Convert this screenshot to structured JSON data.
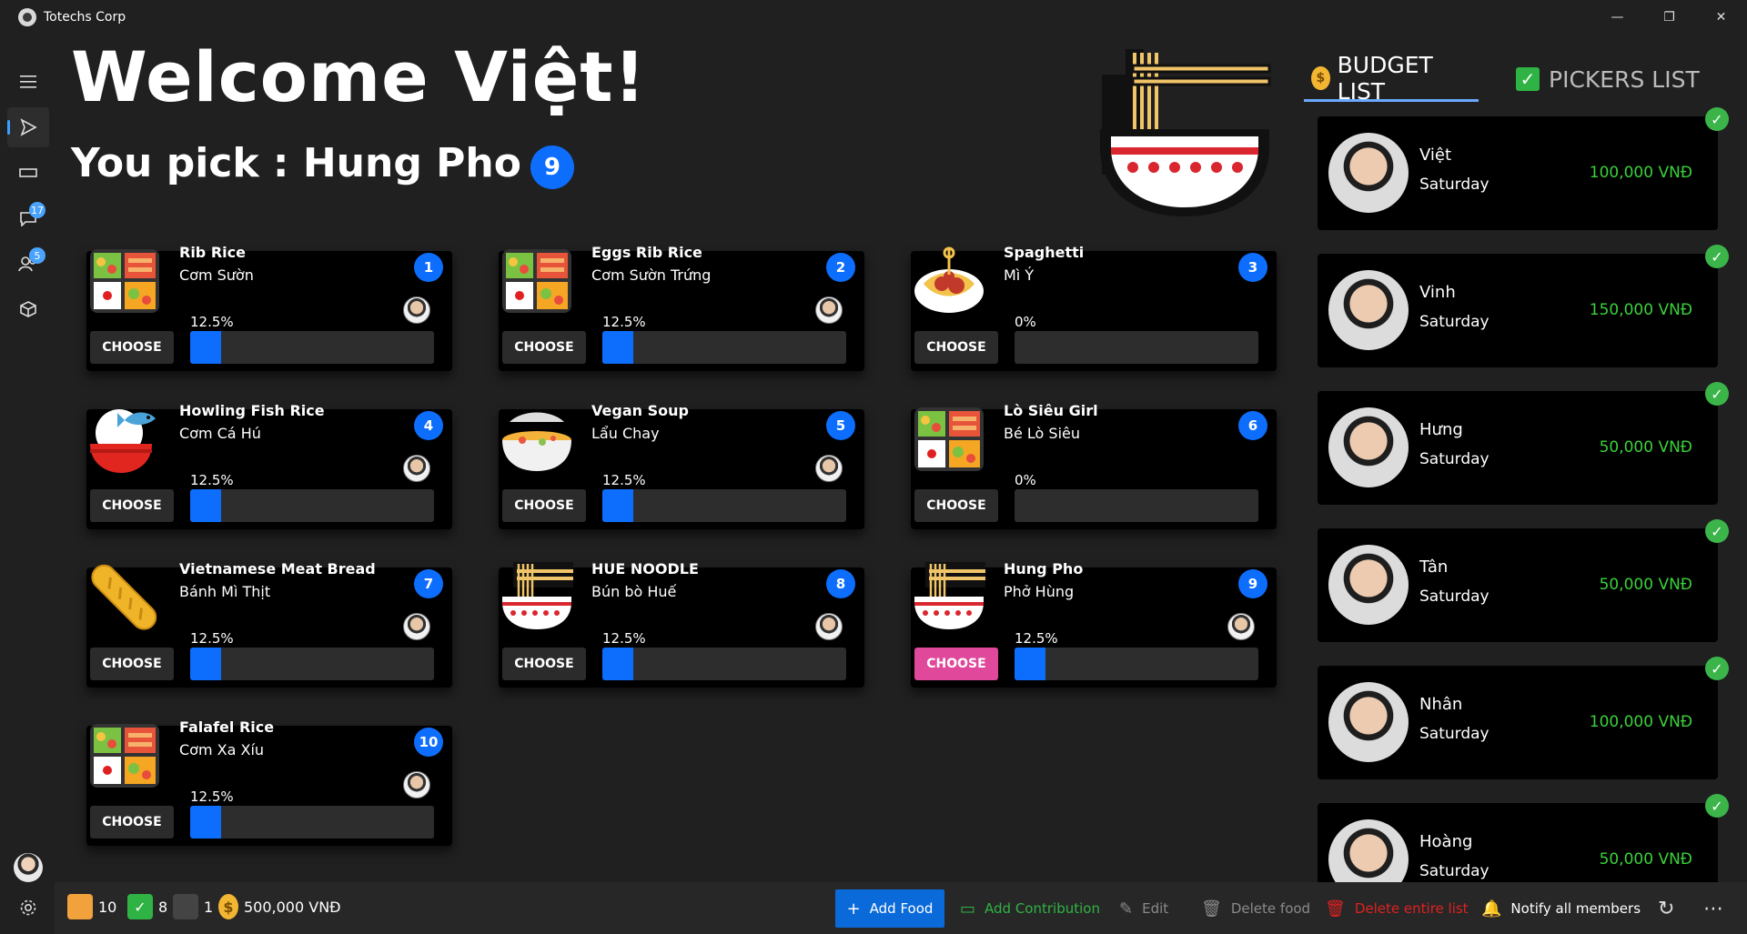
{
  "window": {
    "title": "Totechs Corp",
    "controls": [
      "—",
      "❐",
      "✕"
    ]
  },
  "rail": {
    "items": [
      {
        "name": "menu",
        "icon": "hamburger-icon"
      },
      {
        "name": "food",
        "icon": "send-icon"
      },
      {
        "name": "tray",
        "icon": "tray-icon"
      },
      {
        "name": "chat",
        "icon": "chat-icon",
        "badge": "17"
      },
      {
        "name": "people",
        "icon": "people-icon",
        "badge": "5"
      },
      {
        "name": "box",
        "icon": "package-icon"
      }
    ]
  },
  "header": {
    "welcome": "Welcome Việt!",
    "pick_prefix": "You pick : Hung Pho",
    "pick_number": "9"
  },
  "foods": [
    {
      "name": "Rib Rice",
      "sub": "Cơm Sườn",
      "num": "1",
      "pct": "12.5%",
      "fill": 0.125,
      "img": "bento",
      "chosen": false
    },
    {
      "name": "Eggs Rib Rice",
      "sub": "Cơm Sườn Trứng",
      "num": "2",
      "pct": "12.5%",
      "fill": 0.125,
      "img": "bento",
      "chosen": false
    },
    {
      "name": "Spaghetti",
      "sub": "Mì Ý",
      "num": "3",
      "pct": "0%",
      "fill": 0,
      "img": "spaghetti",
      "chosen": false
    },
    {
      "name": "Howling Fish Rice",
      "sub": "Cơm Cá Hú",
      "num": "4",
      "pct": "12.5%",
      "fill": 0.125,
      "img": "fishrice",
      "chosen": false
    },
    {
      "name": "Vegan Soup",
      "sub": "Lẩu Chay",
      "num": "5",
      "pct": "12.5%",
      "fill": 0.125,
      "img": "soup",
      "chosen": false
    },
    {
      "name": "Lò Siêu Girl",
      "sub": "Bé Lò Siêu",
      "num": "6",
      "pct": "0%",
      "fill": 0,
      "img": "bento",
      "chosen": false
    },
    {
      "name": "Vietnamese Meat Bread",
      "sub": "Bánh Mì Thịt",
      "num": "7",
      "pct": "12.5%",
      "fill": 0.125,
      "img": "bread",
      "chosen": false
    },
    {
      "name": "HUE NOODLE",
      "sub": "Bún bò Huế",
      "num": "8",
      "pct": "12.5%",
      "fill": 0.125,
      "img": "noodle",
      "chosen": false
    },
    {
      "name": "Hung Pho",
      "sub": "Phở Hùng",
      "num": "9",
      "pct": "12.5%",
      "fill": 0.125,
      "img": "noodle",
      "chosen": true
    },
    {
      "name": "Falafel Rice",
      "sub": "Cơm Xa Xíu",
      "num": "10",
      "pct": "12.5%",
      "fill": 0.125,
      "img": "bento",
      "chosen": false
    }
  ],
  "choose_label": "CHOOSE",
  "tabs": {
    "budget": "BUDGET LIST",
    "pickers": "PICKERS LIST"
  },
  "members": [
    {
      "name": "Việt",
      "day": "Saturday",
      "amount": "100,000 VNĐ"
    },
    {
      "name": "Vinh",
      "day": "Saturday",
      "amount": "150,000 VNĐ"
    },
    {
      "name": "Hưng",
      "day": "Saturday",
      "amount": "50,000 VNĐ"
    },
    {
      "name": "Tân",
      "day": "Saturday",
      "amount": "50,000 VNĐ"
    },
    {
      "name": "Nhân",
      "day": "Saturday",
      "amount": "100,000 VNĐ"
    },
    {
      "name": "Hoàng",
      "day": "Saturday",
      "amount": "50,000 VNĐ"
    }
  ],
  "bottom": {
    "food_count": "10",
    "picked_count": "8",
    "member_count": "1",
    "budget_total": "500,000 VNĐ",
    "add_food": "Add Food",
    "add_contribution": "Add Contribution",
    "edit": "Edit",
    "delete_food": "Delete food",
    "delete_list": "Delete entire list",
    "notify": "Notify all members",
    "more": "⋯"
  },
  "colors": {
    "accent": "#0d6efd",
    "chosen": "#e0489b",
    "money": "#3ad13a",
    "add_contribution": "#2fb344",
    "delete_list": "#e02020",
    "disabled": "#8a8a8a"
  }
}
